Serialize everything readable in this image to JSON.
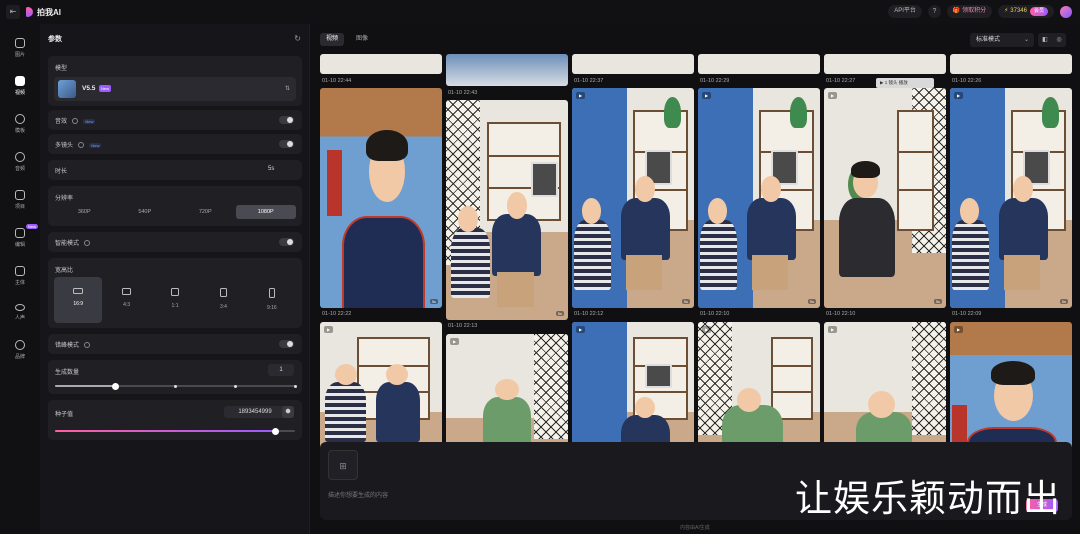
{
  "topbar": {
    "app_name": "拍我AI",
    "back_icon": "back-icon",
    "api_label": "API平台",
    "help_label": "?",
    "gift_label": "领取积分",
    "points": "37346",
    "vip_label": "会员"
  },
  "nav": [
    {
      "label": "图片",
      "icon": "image-icon",
      "active": false
    },
    {
      "label": "视频",
      "icon": "video-icon",
      "active": true
    },
    {
      "label": "模板",
      "icon": "sparkle-icon",
      "active": false
    },
    {
      "label": "音频",
      "icon": "music-icon",
      "active": false
    },
    {
      "label": "项目",
      "icon": "project-icon",
      "active": false
    },
    {
      "label": "编辑",
      "icon": "edit-icon",
      "active": false,
      "badge": "New"
    },
    {
      "label": "主体",
      "icon": "cube-icon",
      "active": false
    },
    {
      "label": "人声",
      "icon": "eye-icon",
      "active": false
    },
    {
      "label": "品牌",
      "icon": "brand-icon",
      "active": false
    }
  ],
  "params": {
    "title": "参数",
    "model_label": "模型",
    "model_name": "V5.5",
    "model_tag": "New",
    "sound_label": "音效",
    "sound_tag": "New",
    "multi_shot_label": "多镜头",
    "multi_shot_tag": "New",
    "duration_label": "时长",
    "duration_value": "5s",
    "resolution_label": "分辨率",
    "resolutions": [
      "360P",
      "540P",
      "720P",
      "1080P"
    ],
    "resolution_selected": "1080P",
    "smart_label": "智能模式",
    "ratio_label": "宽高比",
    "ratios": [
      "16:9",
      "4:3",
      "1:1",
      "3:4",
      "9:16"
    ],
    "ratio_selected": "16:9",
    "offpeak_label": "错峰模式",
    "count_label": "生成数量",
    "count_value": "1",
    "count_slider": 0.25,
    "seed_label": "种子值",
    "seed_value": "1893454999",
    "seed_slider": 0.92
  },
  "main": {
    "tabs": [
      "视频",
      "图像"
    ],
    "active_tab": "视频",
    "mode": "标准模式",
    "play_overlay": "▶ 1 镜头 播放",
    "timestamps_row1": [
      "01-10 22:44",
      "01-10 22:43",
      "01-10 22:37",
      "01-10 22:29",
      "01-10 22:27",
      "01-10 22:26"
    ],
    "timestamps_row2": [
      "01-10 22:22",
      "01-10 22:13",
      "01-10 22:12",
      "01-10 22:10",
      "01-10 22:10",
      "01-10 22:09"
    ],
    "clip_duration": "5s",
    "prompt_placeholder": "描述你想要生成的内容",
    "generate_label": "生成",
    "slogan": "让娱乐颖动而出",
    "footer": "内容由AI生成"
  },
  "colors": {
    "accent_start": "#ff5fa2",
    "accent_end": "#9a5cff",
    "panel": "#16161a",
    "card": "#1f1f24"
  }
}
